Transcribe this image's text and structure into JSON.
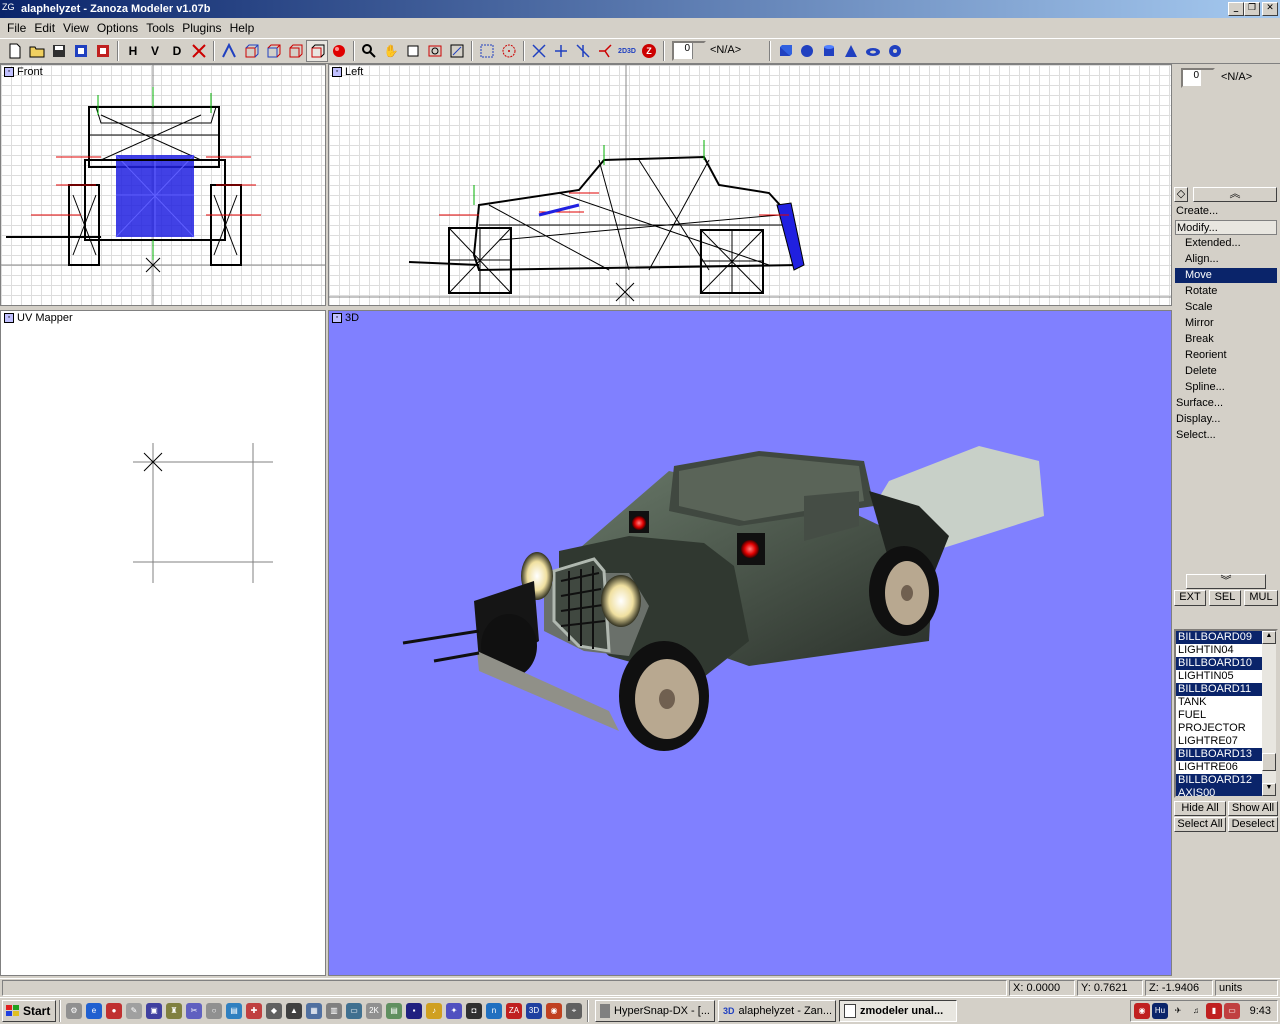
{
  "window": {
    "title": "alaphelyzet - Zanoza Modeler v1.07b",
    "app_icon": "ZG"
  },
  "menu": [
    "File",
    "Edit",
    "View",
    "Options",
    "Tools",
    "Plugins",
    "Help"
  ],
  "toolbar": {
    "letters": [
      "H",
      "V",
      "D"
    ],
    "spinner_value": "0",
    "axis_value": "<N/A>"
  },
  "viewports": {
    "front": "Front",
    "left": "Left",
    "uv": "UV Mapper",
    "three_d": "3D",
    "three_d_bg": "#8080ff"
  },
  "right_panel": {
    "spinner_value": "0",
    "axis_value": "<N/A>",
    "menu": [
      {
        "label": "Create...",
        "sub": false,
        "sel": false,
        "boxed": false
      },
      {
        "label": "Modify...",
        "sub": false,
        "sel": false,
        "boxed": true
      },
      {
        "label": "Extended...",
        "sub": true,
        "sel": false,
        "boxed": false
      },
      {
        "label": "Align...",
        "sub": true,
        "sel": false,
        "boxed": false
      },
      {
        "label": "Move",
        "sub": true,
        "sel": true,
        "boxed": false
      },
      {
        "label": "Rotate",
        "sub": true,
        "sel": false,
        "boxed": false
      },
      {
        "label": "Scale",
        "sub": true,
        "sel": false,
        "boxed": false
      },
      {
        "label": "Mirror",
        "sub": true,
        "sel": false,
        "boxed": false
      },
      {
        "label": "Break",
        "sub": true,
        "sel": false,
        "boxed": false
      },
      {
        "label": "Reorient",
        "sub": true,
        "sel": false,
        "boxed": false
      },
      {
        "label": "Delete",
        "sub": true,
        "sel": false,
        "boxed": false
      },
      {
        "label": "Spline...",
        "sub": true,
        "sel": false,
        "boxed": false
      },
      {
        "label": "Surface...",
        "sub": false,
        "sel": false,
        "boxed": false
      },
      {
        "label": "Display...",
        "sub": false,
        "sel": false,
        "boxed": false
      },
      {
        "label": "Select...",
        "sub": false,
        "sel": false,
        "boxed": false
      }
    ],
    "mode_buttons": [
      "EXT",
      "SEL",
      "MUL"
    ],
    "objects": [
      {
        "name": "BILLBOARD09",
        "sel": true
      },
      {
        "name": "LIGHTIN04",
        "sel": false
      },
      {
        "name": "BILLBOARD10",
        "sel": true
      },
      {
        "name": "LIGHTIN05",
        "sel": false
      },
      {
        "name": "BILLBOARD11",
        "sel": true
      },
      {
        "name": "TANK",
        "sel": false
      },
      {
        "name": "FUEL",
        "sel": false
      },
      {
        "name": "PROJECTOR",
        "sel": false
      },
      {
        "name": "LIGHTRE07",
        "sel": false
      },
      {
        "name": "BILLBOARD13",
        "sel": true
      },
      {
        "name": "LIGHTRE06",
        "sel": false
      },
      {
        "name": "BILLBOARD12",
        "sel": true
      },
      {
        "name": "AXIS00",
        "sel": true
      }
    ],
    "hide_all": "Hide All",
    "show_all": "Show All",
    "select_all": "Select All",
    "deselect": "Deselect"
  },
  "status": {
    "x": "X: 0.0000",
    "y": "Y: 0.7621",
    "z": "Z: -1.9406",
    "units": "units"
  },
  "taskbar": {
    "start": "Start",
    "tasks": [
      {
        "label": "HyperSnap-DX - [...",
        "active": false
      },
      {
        "label": "alaphelyzet - Zan...",
        "active": false
      },
      {
        "label": "zmodeler unal...",
        "active": true
      }
    ],
    "clock": "9:43",
    "tray_lang": "Hu"
  }
}
